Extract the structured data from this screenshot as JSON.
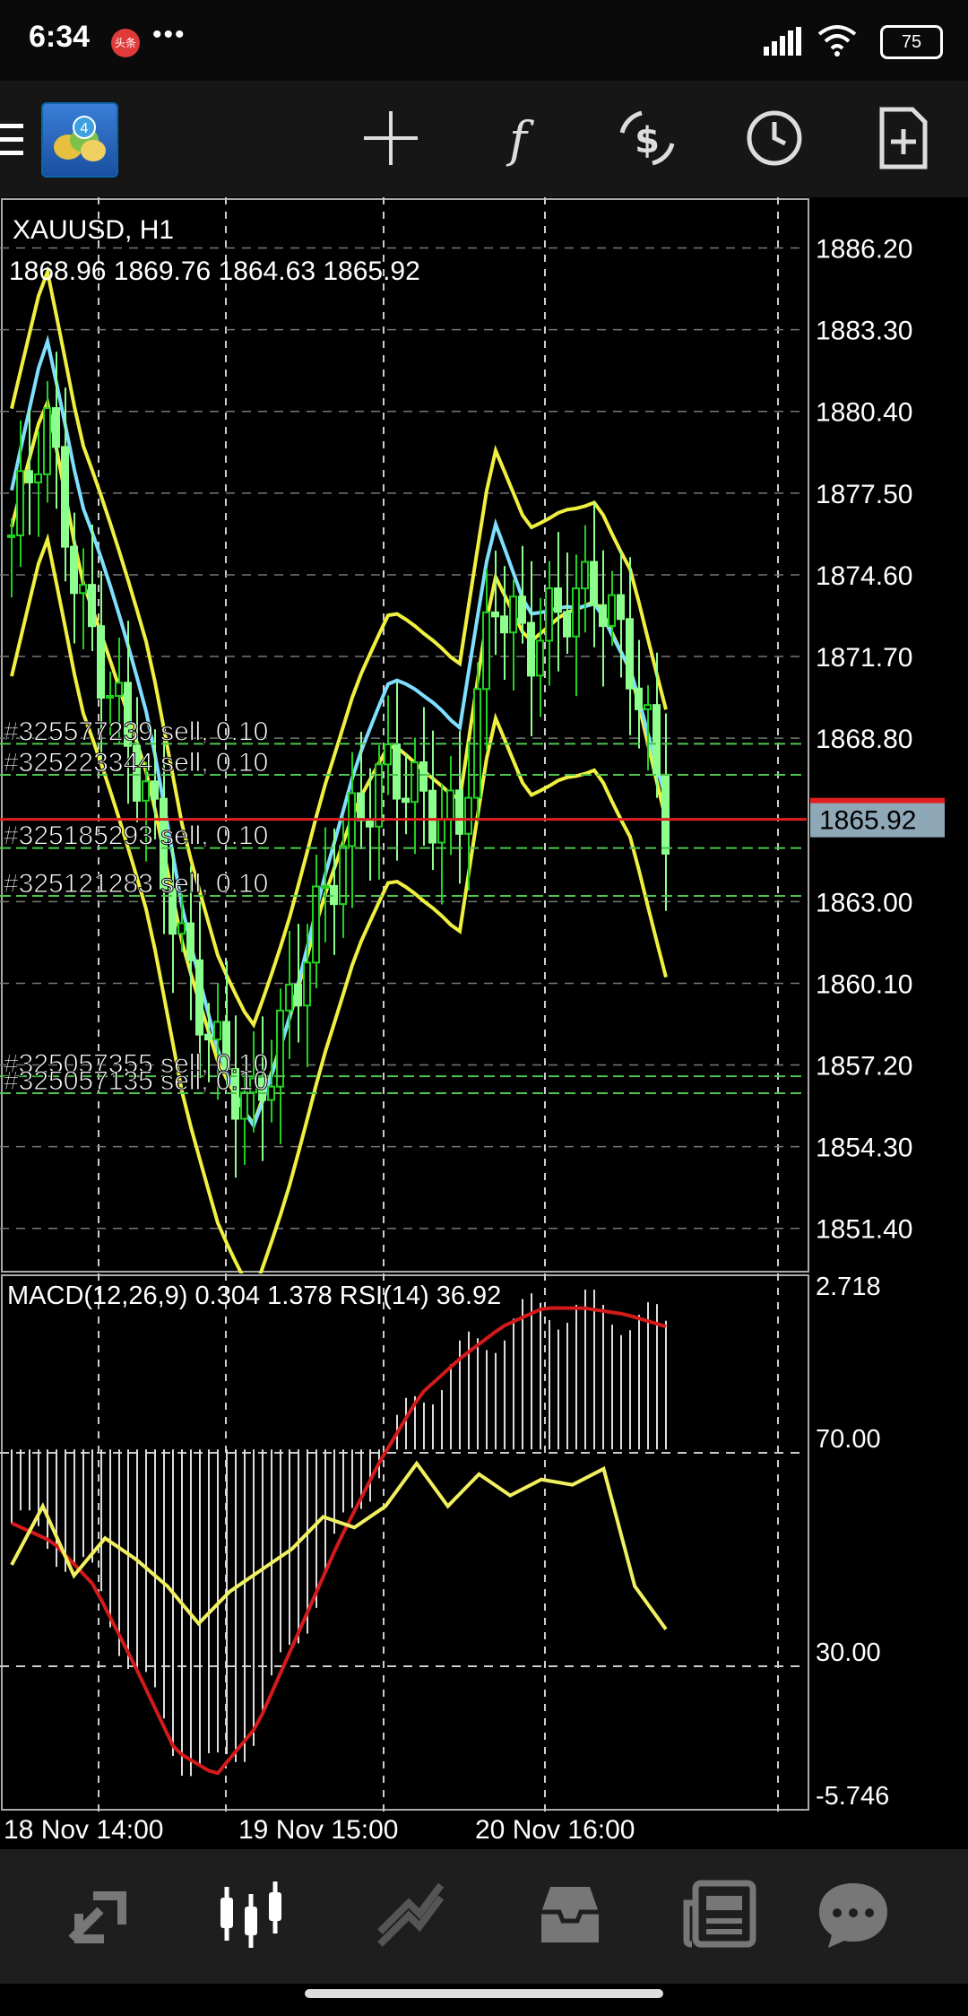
{
  "status_bar": {
    "time": "6:34",
    "notification_badge": "头条",
    "dots": "•••",
    "battery": "75",
    "icons": [
      "signal-icon",
      "wifi-icon",
      "battery-icon"
    ]
  },
  "toolbar": {
    "menu_icon": "hamburger-menu-icon",
    "logo": "metatrader-4-logo",
    "tools": [
      "crosshair-icon",
      "indicators-icon",
      "trade-icon",
      "timeframe-icon",
      "new-order-icon"
    ]
  },
  "chart": {
    "symbol": "XAUUSD, H1",
    "ohlc": "1868.96 1869.76 1864.63 1865.92",
    "current_price": "1865.92",
    "price_levels": [
      "1886.20",
      "1883.30",
      "1880.40",
      "1877.50",
      "1874.60",
      "1871.70",
      "1868.80",
      "1863.00",
      "1860.10",
      "1857.20",
      "1854.30",
      "1851.40"
    ],
    "orders": [
      {
        "label": "#325577239 sell, 0.10",
        "price": 1868.6
      },
      {
        "label": "#325223344 sell, 0.10",
        "price": 1867.5
      },
      {
        "label": "#325185293 sell, 0.10",
        "price": 1864.9
      },
      {
        "label": "#325121283 sell, 0.10",
        "price": 1863.2
      },
      {
        "label": "#325057355 sell, 0.10",
        "price": 1856.8
      },
      {
        "label": "#325057135 sell, 0.10",
        "price": 1856.2
      }
    ],
    "time_labels": [
      "18 Nov 14:00",
      "19 Nov 15:00",
      "20 Nov 16:00"
    ],
    "colors": {
      "bull": "#22d022",
      "bear": "#8cff8c",
      "band": "#f0f040",
      "ma": "#7fdfff",
      "price_line": "#e02020",
      "price_box": "#8fa8b8"
    }
  },
  "chart_data": {
    "type": "line",
    "title": "XAUUSD, H1",
    "ylim": [
      1849.8,
      1888.0
    ],
    "series": [
      {
        "name": "XAUUSD",
        "values": [
          1876.0,
          1880.2,
          1873.5,
          1870.0,
          1866.5,
          1861.0,
          1857.5,
          1855.5,
          1859.0,
          1863.0,
          1866.0,
          1867.8,
          1866.5,
          1865.5,
          1874.0,
          1872.0,
          1873.5,
          1874.2,
          1871.5,
          1865.9
        ]
      }
    ]
  },
  "indicator": {
    "caption": "MACD(12,26,9) 0.304 1.378 RSI(14) 36.92",
    "macd_top": "2.718",
    "macd_bottom": "-5.746",
    "rsi_high": "70.00",
    "rsi_low": "30.00",
    "macd_signal_values": [
      -1.2,
      -1.5,
      -2.2,
      -3.5,
      -4.9,
      -5.3,
      -4.5,
      -3.0,
      -1.5,
      -0.2,
      0.9,
      1.5,
      2.0,
      2.3,
      2.3,
      2.2,
      2.0
    ],
    "rsi_values": [
      49,
      60,
      47,
      54,
      50,
      45,
      38,
      44,
      48,
      52,
      58,
      56,
      60,
      68,
      60,
      66,
      62,
      65,
      64,
      67,
      45,
      36.92
    ]
  },
  "nav": {
    "items": [
      "quotes-icon",
      "chart-icon",
      "trade-icon",
      "history-icon",
      "news-icon",
      "messages-icon"
    ]
  }
}
